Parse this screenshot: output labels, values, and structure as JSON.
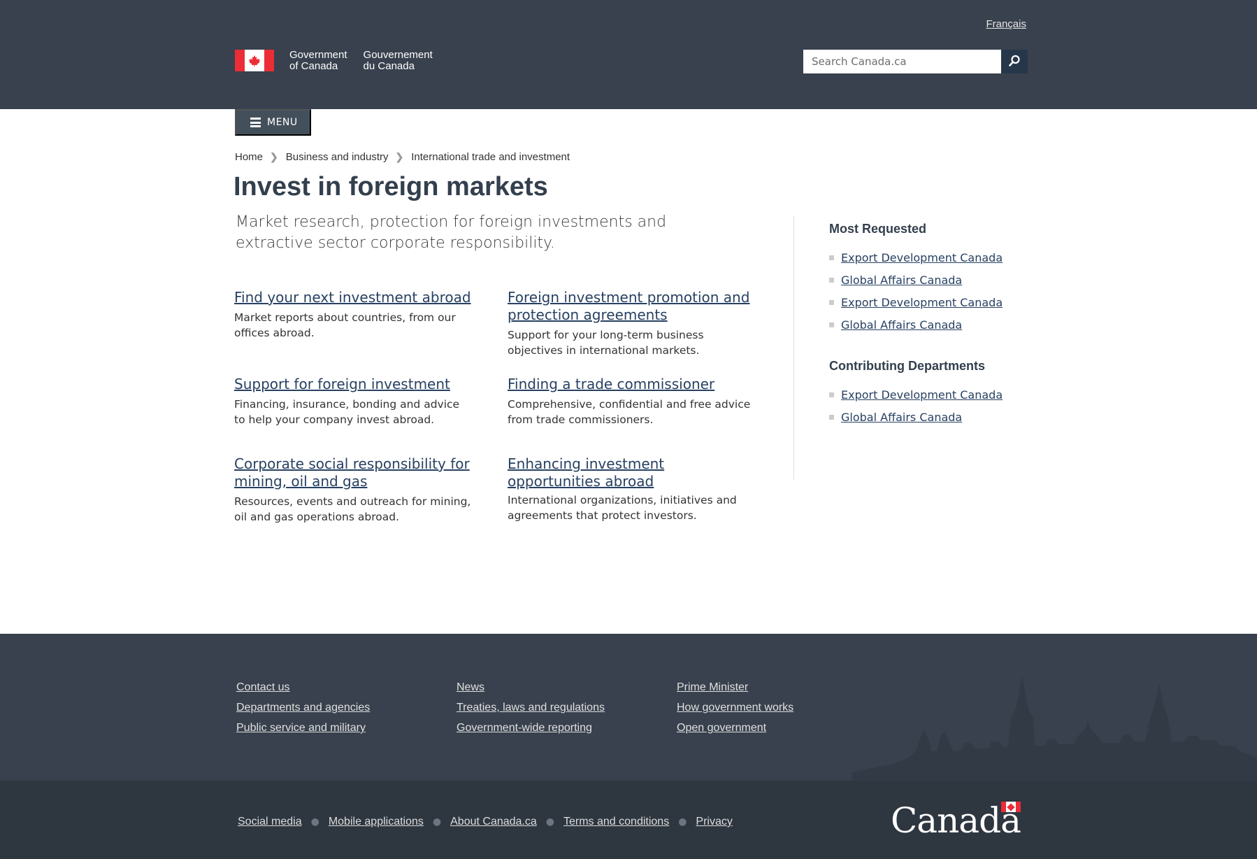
{
  "header": {
    "lang_toggle": "Français",
    "signature_en_line1": "Government",
    "signature_en_line2": "of Canada",
    "signature_fr_line1": "Gouvernement",
    "signature_fr_line2": "du Canada",
    "search_placeholder": "Search Canada.ca",
    "flag_glyph": "🍁"
  },
  "menu": {
    "label": "MENU"
  },
  "breadcrumb": [
    "Home",
    "Business and industry",
    "International trade and investment"
  ],
  "page": {
    "title": "Invest in foreign markets",
    "lead": "Market research, protection for foreign investments and extractive sector corporate responsibility."
  },
  "cards": [
    {
      "title": "Find your next investment abroad",
      "desc": "Market reports about countries, from our offices abroad."
    },
    {
      "title": "Foreign investment promotion and protection agreements",
      "desc": "Support for your long-term business objectives in international markets."
    },
    {
      "title": "Support for foreign investment",
      "desc": "Financing, insurance, bonding and advice to help your company invest abroad."
    },
    {
      "title": "Finding a trade commissioner",
      "desc": "Comprehensive, confidential and free advice from trade commissioners."
    },
    {
      "title": "Corporate social responsibility for mining, oil and gas",
      "desc": "Resources, events and outreach for mining, oil and gas operations abroad."
    },
    {
      "title": "Enhancing investment opportunities abroad",
      "desc": "International organizations, initiatives and agreements that protect investors."
    }
  ],
  "sidebar": {
    "most_requested": {
      "heading": "Most Requested",
      "links": [
        "Export Development Canada",
        "Global Affairs Canada",
        "Export Development Canada",
        "Global Affairs Canada"
      ]
    },
    "contributing": {
      "heading": "Contributing Departments",
      "links": [
        "Export Development Canada",
        "Global Affairs Canada"
      ]
    }
  },
  "footer": {
    "col1": [
      "Contact us",
      "Departments and agencies",
      "Public service and military"
    ],
    "col2": [
      "News",
      "Treaties, laws and regulations",
      "Government-wide reporting"
    ],
    "col3": [
      "Prime Minister",
      "How government works",
      "Open government"
    ],
    "bottom_links": [
      "Social media",
      "Mobile applications",
      "About Canada.ca",
      "Terms and conditions",
      "Privacy"
    ],
    "wordmark": "Canada"
  },
  "colors": {
    "header_bg": "#38414d",
    "link": "#284162",
    "flag_red": "#eb2d37",
    "footer_bg": "#38414d",
    "footer_bottom_bg": "#2e3640"
  }
}
